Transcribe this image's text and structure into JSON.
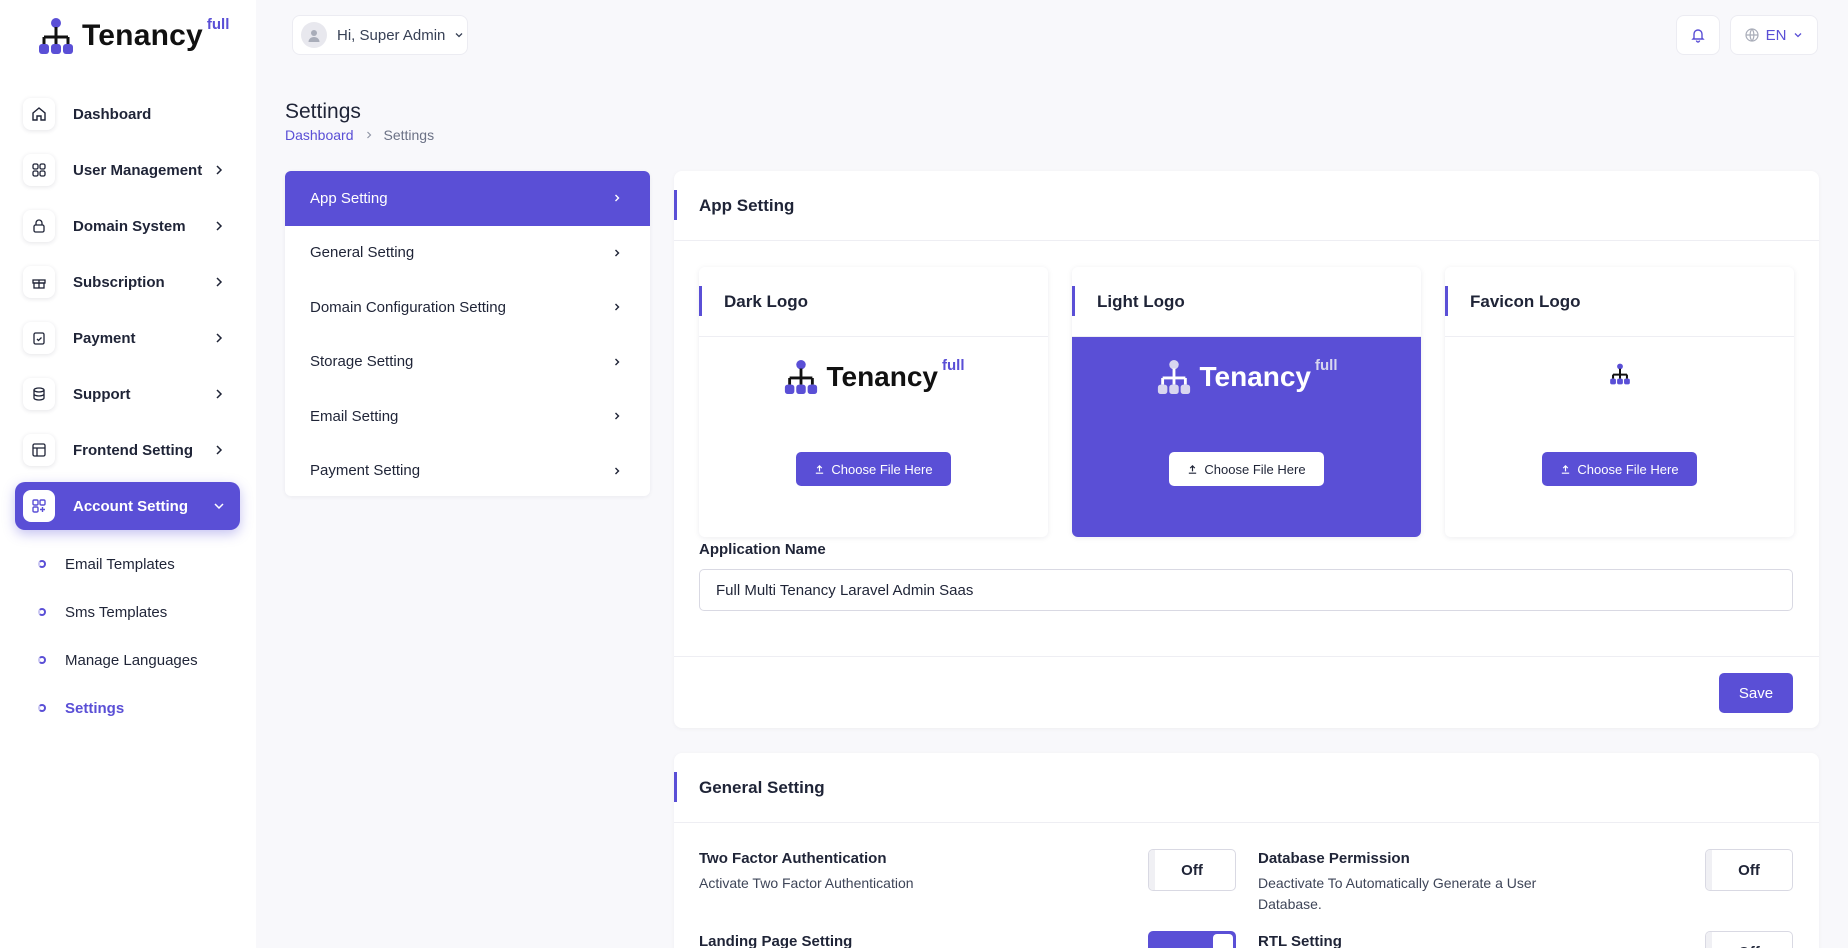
{
  "brand": {
    "name": "Tenancy",
    "sup": "full",
    "accent": "#5a4fd6"
  },
  "topbar": {
    "greeting": "Hi, Super Admin",
    "language": "EN"
  },
  "sidebar": {
    "items": [
      {
        "label": "Dashboard",
        "icon": "home-icon"
      },
      {
        "label": "User Management",
        "icon": "grid-icon"
      },
      {
        "label": "Domain System",
        "icon": "lock-icon"
      },
      {
        "label": "Subscription",
        "icon": "gift-icon"
      },
      {
        "label": "Payment",
        "icon": "clipboard-icon"
      },
      {
        "label": "Support",
        "icon": "database-icon"
      },
      {
        "label": "Frontend Setting",
        "icon": "layout-icon"
      },
      {
        "label": "Account Setting",
        "icon": "apps-add-icon"
      }
    ],
    "subitems": [
      "Email Templates",
      "Sms Templates",
      "Manage Languages",
      "Settings"
    ]
  },
  "page": {
    "title": "Settings",
    "breadcrumb": [
      "Dashboard",
      "Settings"
    ]
  },
  "settings_menu": [
    "App Setting",
    "General Setting",
    "Domain Configuration Setting",
    "Storage Setting",
    "Email Setting",
    "Payment Setting"
  ],
  "app_setting": {
    "title": "App Setting",
    "logos": [
      {
        "title": "Dark Logo",
        "button": "Choose File Here"
      },
      {
        "title": "Light Logo",
        "button": "Choose File Here"
      },
      {
        "title": "Favicon Logo",
        "button": "Choose File Here"
      }
    ],
    "app_name_label": "Application Name",
    "app_name_value": "Full Multi Tenancy Laravel Admin Saas",
    "save_label": "Save"
  },
  "general_setting": {
    "title": "General Setting",
    "rows": [
      {
        "title": "Two Factor Authentication",
        "desc": "Activate Two Factor Authentication",
        "state": "Off"
      },
      {
        "title": "Database Permission",
        "desc": "Deactivate To Automatically Generate a User Database.",
        "state": "Off"
      },
      {
        "title": "Landing Page Setting",
        "desc": "",
        "state": "On"
      },
      {
        "title": "RTL Setting",
        "desc": "",
        "state": "Off"
      }
    ]
  }
}
